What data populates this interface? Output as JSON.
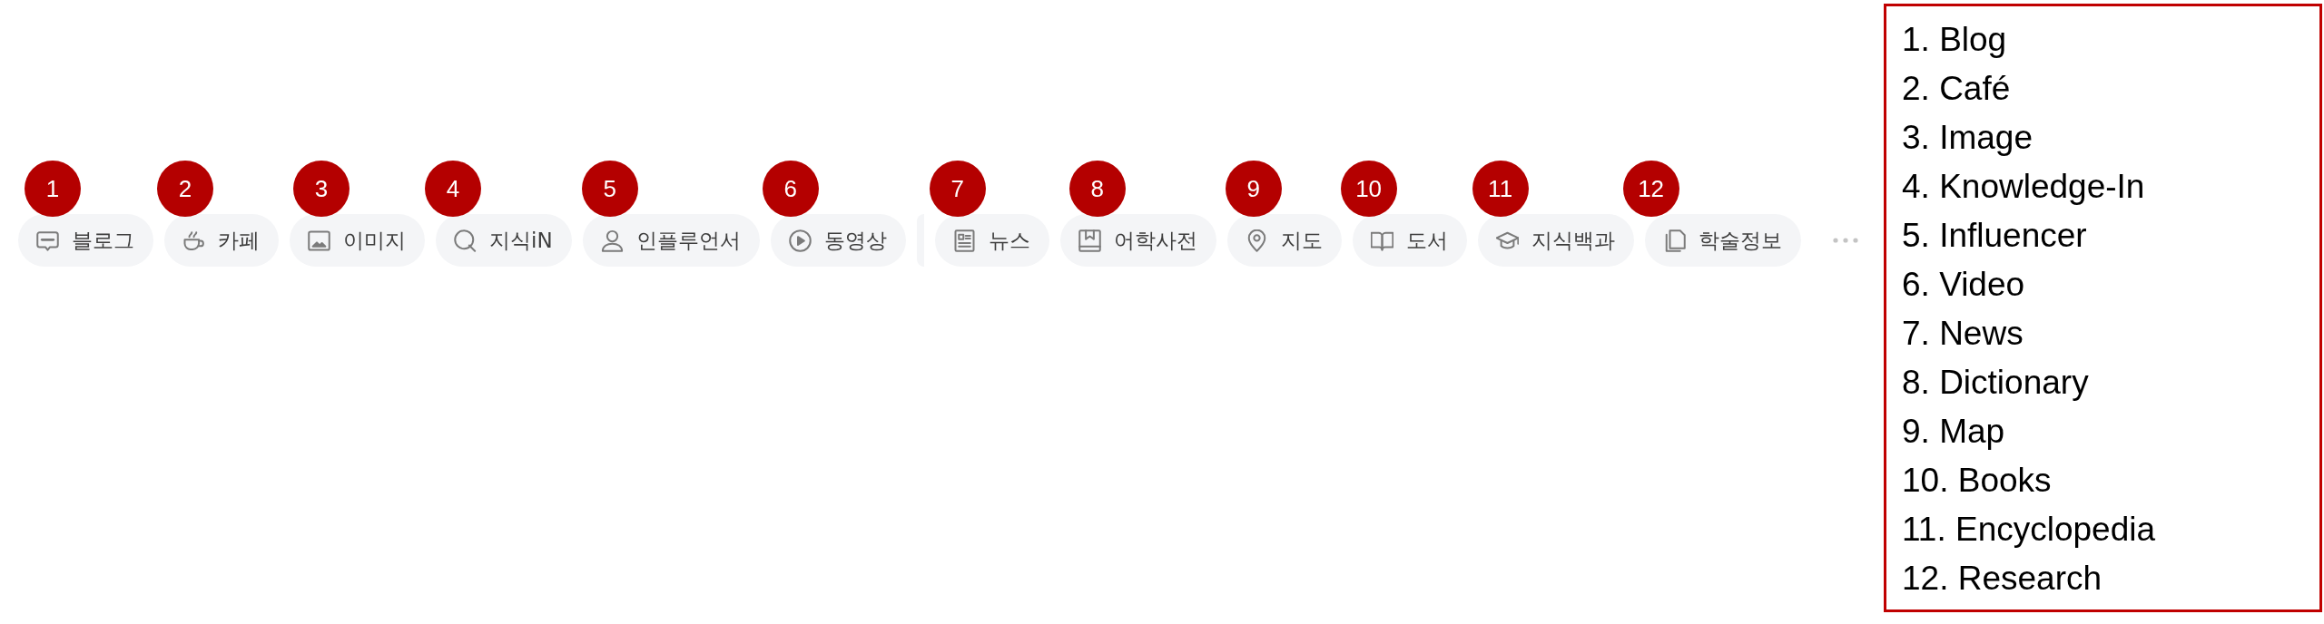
{
  "tabs": [
    {
      "badge": "1",
      "label": "블로그",
      "selected": false
    },
    {
      "badge": "2",
      "label": "카페",
      "selected": false
    },
    {
      "badge": "3",
      "label": "이미지",
      "selected": false
    },
    {
      "badge": "4",
      "label": "지식iN",
      "selected": false
    },
    {
      "badge": "5",
      "label": "인플루언서",
      "selected": false
    },
    {
      "badge": "6",
      "label": "동영상",
      "selected": false
    },
    {
      "badge": "7",
      "label": "뉴스",
      "selected": false
    },
    {
      "badge": "8",
      "label": "어학사전",
      "selected": false
    },
    {
      "badge": "9",
      "label": "지도",
      "selected": false
    },
    {
      "badge": "10",
      "label": "도서",
      "selected": false
    },
    {
      "badge": "11",
      "label": "지식백과",
      "selected": false
    },
    {
      "badge": "12",
      "label": "학술정보",
      "selected": false
    }
  ],
  "legend": [
    "1. Blog",
    "2. Café",
    "3. Image",
    "4. Knowledge-In",
    "5. Influencer",
    "6. Video",
    "7. News",
    "8. Dictionary",
    "9. Map",
    "10. Books",
    "11. Encyclopedia",
    "12. Research"
  ]
}
